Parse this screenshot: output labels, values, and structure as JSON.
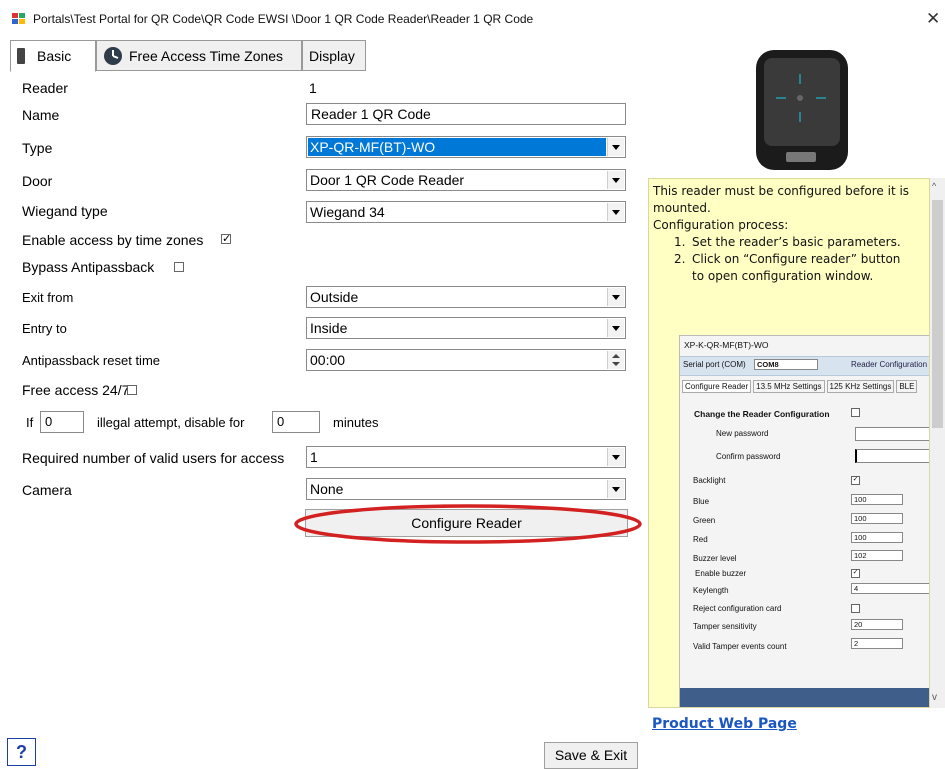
{
  "window": {
    "title": "Portals\\Test Portal for QR Code\\QR Code EWSI \\Door 1 QR Code Reader\\Reader 1 QR Code",
    "close_glyph": "✕"
  },
  "tabs": [
    {
      "label": "Basic",
      "icon": "reader-icon",
      "active": true
    },
    {
      "label": "Free Access Time Zones",
      "icon": "clock-icon",
      "active": false
    },
    {
      "label": "Display",
      "active": false
    }
  ],
  "form": {
    "reader_label": "Reader",
    "reader_value": "1",
    "name_label": "Name",
    "name_value": "Reader 1 QR Code",
    "type_label": "Type",
    "type_value": "XP-QR-MF(BT)-WO",
    "door_label": "Door",
    "door_value": "Door 1 QR Code Reader",
    "wiegand_label": "Wiegand type",
    "wiegand_value": "Wiegand 34",
    "enable_tz_label": "Enable access by time zones",
    "enable_tz_checked": true,
    "bypass_label": "Bypass Antipassback",
    "bypass_checked": false,
    "exit_label": "Exit from",
    "exit_value": "Outside",
    "entry_label": "Entry to",
    "entry_value": "Inside",
    "apb_reset_label": "Antipassback reset time",
    "apb_reset_value": "00:00",
    "free_access_label": "Free access 24/7",
    "free_access_checked": false,
    "illegal_if": "If",
    "illegal_attempts_value": "0",
    "illegal_mid": "illegal attempt, disable for",
    "illegal_minutes_value": "0",
    "illegal_minutes_label": "minutes",
    "required_users_label": "Required number of valid users for access",
    "required_users_value": "1",
    "camera_label": "Camera",
    "camera_value": "None",
    "configure_button": "Configure Reader"
  },
  "info": {
    "intro": "This reader must be configured before it is mounted.",
    "process_title": "Configuration process:",
    "steps": [
      "Set the reader’s basic parameters.",
      "Click on “Configure reader” button to open configuration window."
    ],
    "mini_window": {
      "title": "XP-K-QR-MF(BT)-WO",
      "serial_label": "Serial port (COM)",
      "serial_value": "COM8",
      "reader_config": "Reader Configuration",
      "tabs": [
        "Configure Reader",
        "13.5 MHz Settings",
        "125 KHz Settings",
        "BLE"
      ],
      "change_config": "Change the Reader Configuration",
      "new_password": "New password",
      "confirm_password": "Confirm password",
      "backlight": "Backlight",
      "blue": "Blue",
      "blue_value": "100",
      "green": "Green",
      "green_value": "100",
      "red": "Red",
      "red_value": "100",
      "buzzer_level": "Buzzer level",
      "buzzer_level_value": "102",
      "enable_buzzer": "Enable buzzer",
      "keylength": "Keylength",
      "keylength_value": "4",
      "reject_card": "Reject configuration card",
      "tamper_sens": "Tamper sensitivity",
      "tamper_sens_value": "20",
      "tamper_count": "Valid Tamper events count",
      "tamper_count_value": "2"
    }
  },
  "links": {
    "product_page": "Product Web Page"
  },
  "footer": {
    "help": "?",
    "save_exit": "Save & Exit"
  },
  "colors": {
    "info_bg": "#ffffc4",
    "selection": "#0078d7",
    "link": "#1a56c4",
    "annotation_ring": "#d32020"
  }
}
